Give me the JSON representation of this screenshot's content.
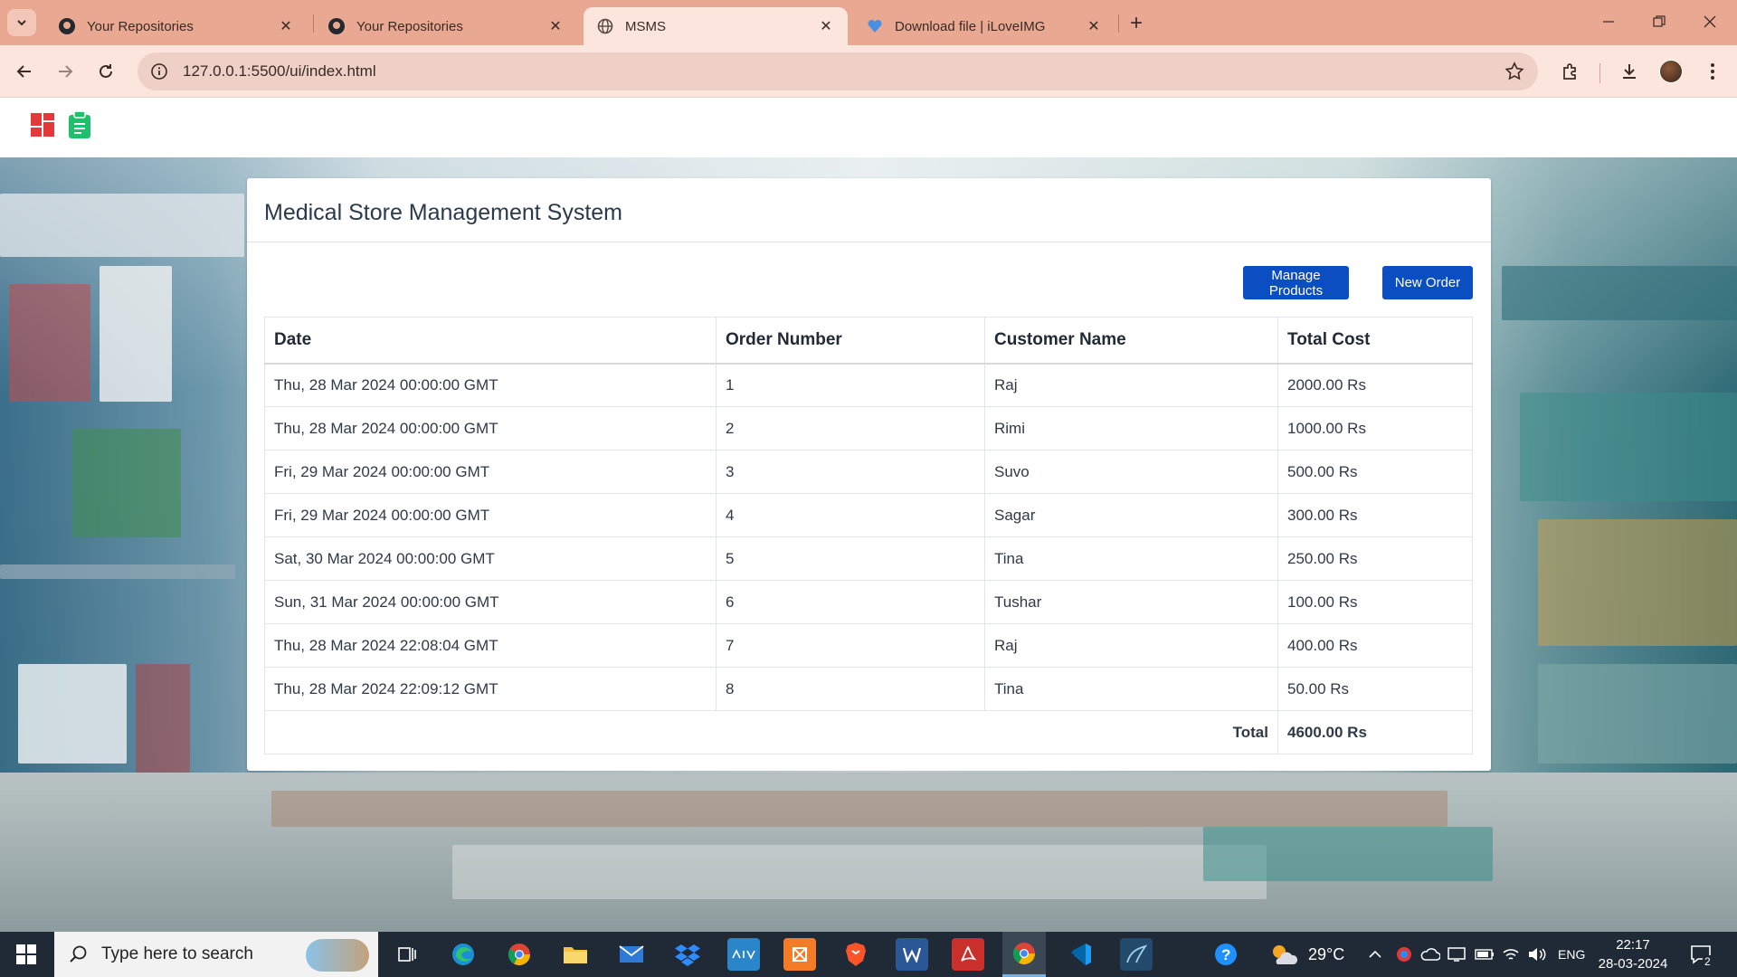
{
  "browser": {
    "tabs": [
      {
        "title": "Your Repositories",
        "icon": "github-icon",
        "active": false
      },
      {
        "title": "Your Repositories",
        "icon": "github-icon",
        "active": false
      },
      {
        "title": "MSMS",
        "icon": "globe-icon",
        "active": true
      },
      {
        "title": "Download file | iLoveIMG",
        "icon": "iloveimg-icon",
        "active": false
      }
    ],
    "url": "127.0.0.1:5500/ui/index.html"
  },
  "app": {
    "title": "Medical Store Management System",
    "buttons": {
      "manage_products": "Manage Products",
      "new_order": "New Order"
    },
    "table": {
      "headers": [
        "Date",
        "Order Number",
        "Customer Name",
        "Total Cost"
      ],
      "rows": [
        {
          "date": "Thu, 28 Mar 2024 00:00:00 GMT",
          "order": "1",
          "customer": "Raj",
          "cost": "2000.00 Rs"
        },
        {
          "date": "Thu, 28 Mar 2024 00:00:00 GMT",
          "order": "2",
          "customer": "Rimi",
          "cost": "1000.00 Rs"
        },
        {
          "date": "Fri, 29 Mar 2024 00:00:00 GMT",
          "order": "3",
          "customer": "Suvo",
          "cost": "500.00 Rs"
        },
        {
          "date": "Fri, 29 Mar 2024 00:00:00 GMT",
          "order": "4",
          "customer": "Sagar",
          "cost": "300.00 Rs"
        },
        {
          "date": "Sat, 30 Mar 2024 00:00:00 GMT",
          "order": "5",
          "customer": "Tina",
          "cost": "250.00 Rs"
        },
        {
          "date": "Sun, 31 Mar 2024 00:00:00 GMT",
          "order": "6",
          "customer": "Tushar",
          "cost": "100.00 Rs"
        },
        {
          "date": "Thu, 28 Mar 2024 22:08:04 GMT",
          "order": "7",
          "customer": "Raj",
          "cost": "400.00 Rs"
        },
        {
          "date": "Thu, 28 Mar 2024 22:09:12 GMT",
          "order": "8",
          "customer": "Tina",
          "cost": "50.00 Rs"
        }
      ],
      "total_label": "Total",
      "total_value": "4600.00 Rs"
    }
  },
  "taskbar": {
    "search_placeholder": "Type here to search",
    "temperature": "29°C",
    "language": "ENG",
    "time": "22:17",
    "date": "28-03-2024",
    "notification_count": "2"
  },
  "colors": {
    "primary_button": "#0a4ec2",
    "tab_strip": "#e9a892",
    "toolbar": "#fbe5dc"
  }
}
